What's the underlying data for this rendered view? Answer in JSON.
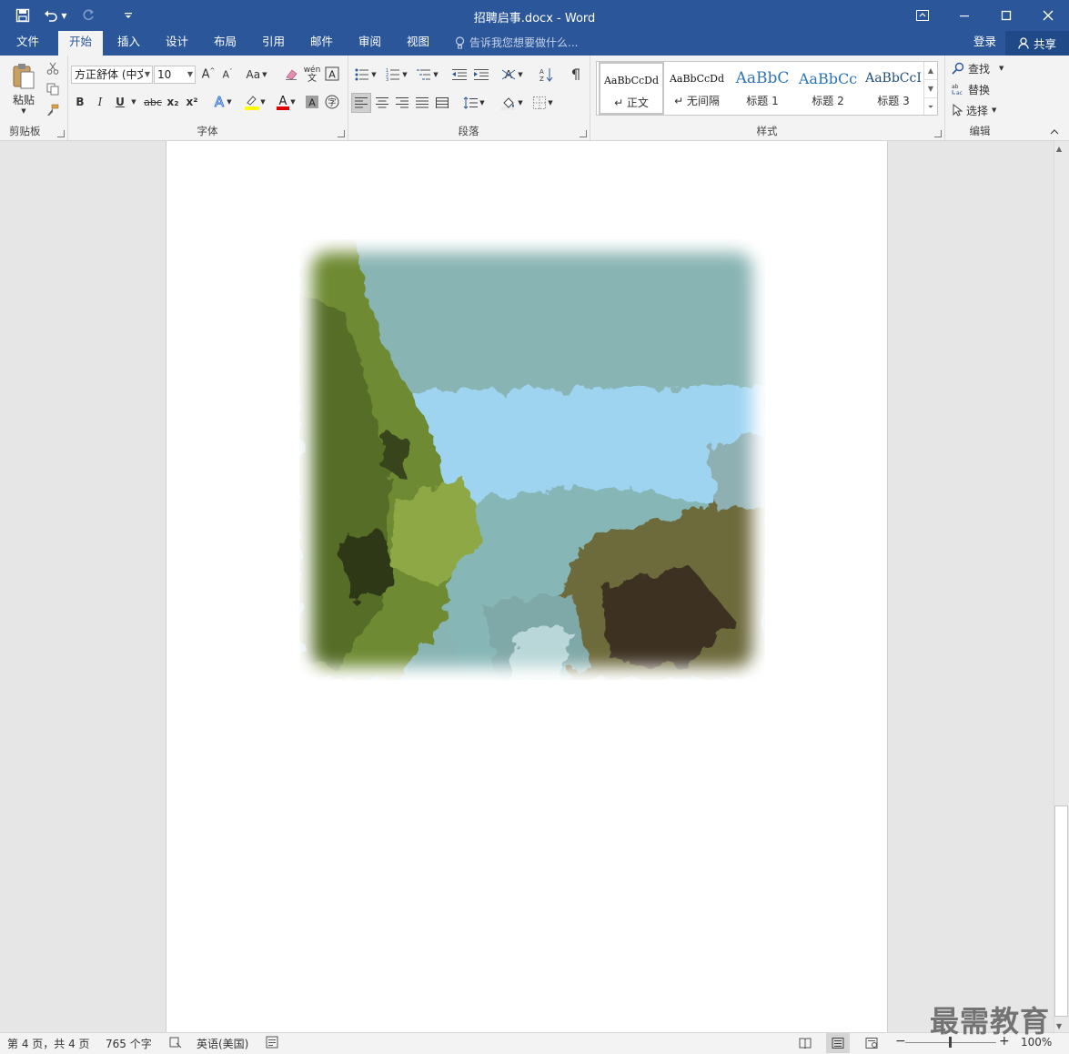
{
  "window": {
    "title": "招聘启事.docx - Word"
  },
  "qat": {
    "customize_icon": "qat-customize-icon"
  },
  "tabs": [
    {
      "label": "文件"
    },
    {
      "label": "开始"
    },
    {
      "label": "插入"
    },
    {
      "label": "设计"
    },
    {
      "label": "布局"
    },
    {
      "label": "引用"
    },
    {
      "label": "邮件"
    },
    {
      "label": "审阅"
    },
    {
      "label": "视图"
    }
  ],
  "tellme": {
    "placeholder": "告诉我您想要做什么..."
  },
  "account": {
    "login": "登录",
    "share": "共享"
  },
  "ribbon": {
    "clipboard": {
      "label": "剪贴板",
      "paste": "粘贴"
    },
    "font": {
      "label": "字体",
      "font_name": "方正舒体 (中文",
      "font_size": "10",
      "change_case": "Aa",
      "phonetic": "wén",
      "bold": "B",
      "italic": "I",
      "underline": "U",
      "strike": "abc",
      "subscript": "x₂",
      "superscript": "x²"
    },
    "paragraph": {
      "label": "段落"
    },
    "styles": {
      "label": "样式",
      "items": [
        {
          "sample": "AaBbCcDd",
          "name": "↵ 正文"
        },
        {
          "sample": "AaBbCcDd",
          "name": "↵ 无间隔"
        },
        {
          "sample": "AaBbC",
          "name": "标题 1"
        },
        {
          "sample": "AaBbCc",
          "name": "标题 2"
        },
        {
          "sample": "AaBbCcI",
          "name": "标题 3"
        }
      ]
    },
    "editing": {
      "label": "编辑",
      "find": "查找",
      "replace": "替换",
      "select": "选择"
    }
  },
  "status": {
    "page": "第 4 页，共 4 页",
    "words": "765 个字",
    "language": "英语(美国)",
    "zoom": "100%"
  },
  "watermark": "最需教育",
  "colors": {
    "brand": "#2b579a",
    "highlight": "#ffff00",
    "font_color": "#e00000"
  }
}
